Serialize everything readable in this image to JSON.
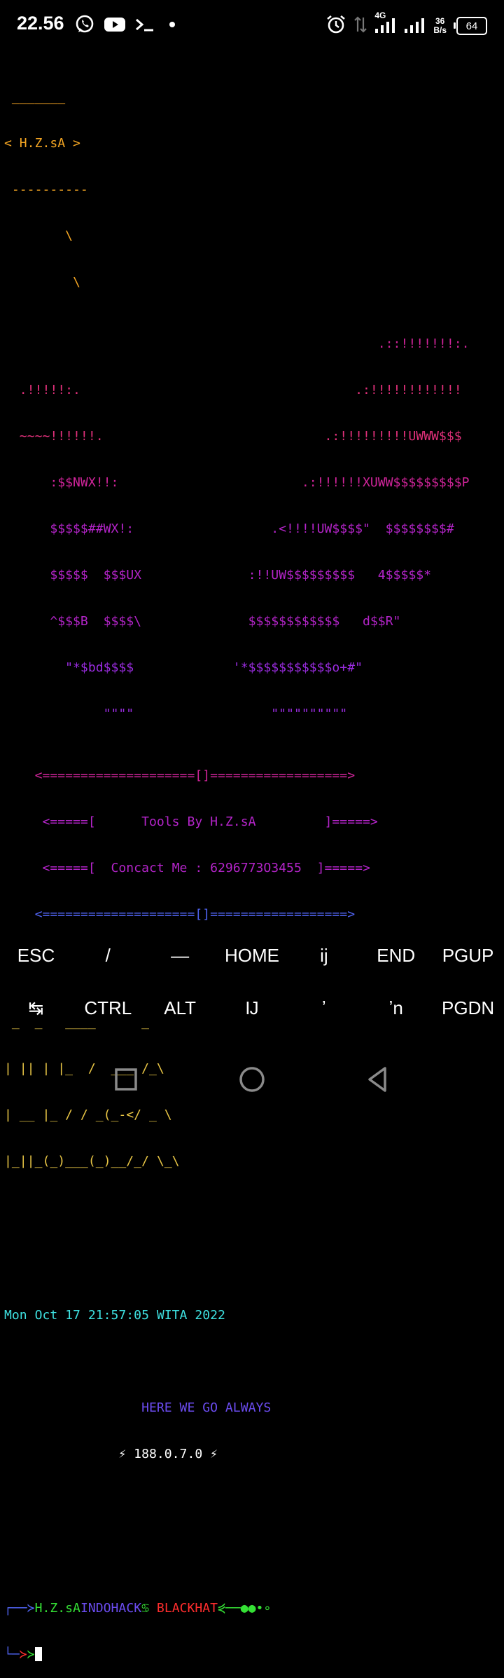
{
  "status_bar": {
    "time": "22.56",
    "network_type": "4G",
    "speed_value": "36",
    "speed_unit": "B/s",
    "battery": "64",
    "icons": [
      "whatsapp-icon",
      "youtube-icon",
      "terminal-icon",
      "dot-icon",
      "alarm-icon",
      "data-arrows-icon",
      "signal-icon",
      "signal-icon-2"
    ]
  },
  "terminal": {
    "bubble_top": " _______",
    "bubble_text": "< H.Z.sA >",
    "bubble_bottom": " ----------",
    "slash1": "        \\",
    "slash2": "         \\",
    "art": [
      "                                                 .::!!!!!!!:.",
      "  .!!!!!:.                                    .:!!!!!!!!!!!!",
      "  ~~~~!!!!!!.                             .:!!!!!!!!!UWWW$$$",
      "      :$$NWX!!:                        .:!!!!!!XUWW$$$$$$$$$P",
      "      $$$$$##WX!:                  .<!!!!UW$$$$\"  $$$$$$$$#",
      "      $$$$$  $$$UX              :!!UW$$$$$$$$$   4$$$$$*",
      "      ^$$$B  $$$$\\              $$$$$$$$$$$$   d$$R\"",
      "        \"*$bd$$$$             '*$$$$$$$$$$$o+#\"",
      "             \"\"\"\"                  \"\"\"\"\"\"\"\"\"\""
    ],
    "banner_top": "    <====================[]==================>",
    "banner_tools": "     <=====[      Tools By H.Z.sA         ]=====>",
    "banner_contact": "     <=====[  Concact Me : 6296773O3455  ]=====>",
    "banner_bottom": "    <====================[]==================>",
    "figlet": [
      " _  _   ____      _",
      "| || | |_  /  ___ /_\\",
      "| __ |_ / / _(_-</ _ \\",
      "|_||_(_)___(_)__/_/ \\_\\"
    ],
    "date_line": "Mon Oct 17 21:57:05 WITA 2022",
    "motto": "                  HERE WE GO ALWAYS",
    "version": "               ⚡ 188.0.7.0 ⚡",
    "prompt_box_top": "┌──",
    "prompt_arrow": "≻",
    "prompt_user": "H.Z.sA",
    "prompt_host": "INDOHACK",
    "prompt_sep": "♋",
    "prompt_tag": " BLACKHAT",
    "prompt_tail": "⋞──●●•∘",
    "prompt_box_bottom": "└─",
    "prompt_arrow2_red": "≻",
    "prompt_arrow2_green": "≻"
  },
  "extra_keys": {
    "row1": [
      "ESC",
      "/",
      "—",
      "HOME",
      "ij",
      "END",
      "PGUP"
    ],
    "row2": [
      "↹",
      "CTRL",
      "ALT",
      "Ĳ",
      "ʼ",
      "ʼn",
      "PGDN"
    ]
  },
  "colors": {
    "background": "#000000",
    "orange": "#f5a623",
    "magenta": "#d0249a",
    "blue": "#4f63f0",
    "yellow": "#e8c545",
    "cyan": "#3ee0e0",
    "green": "#35e035",
    "red": "#ff2d2d"
  }
}
